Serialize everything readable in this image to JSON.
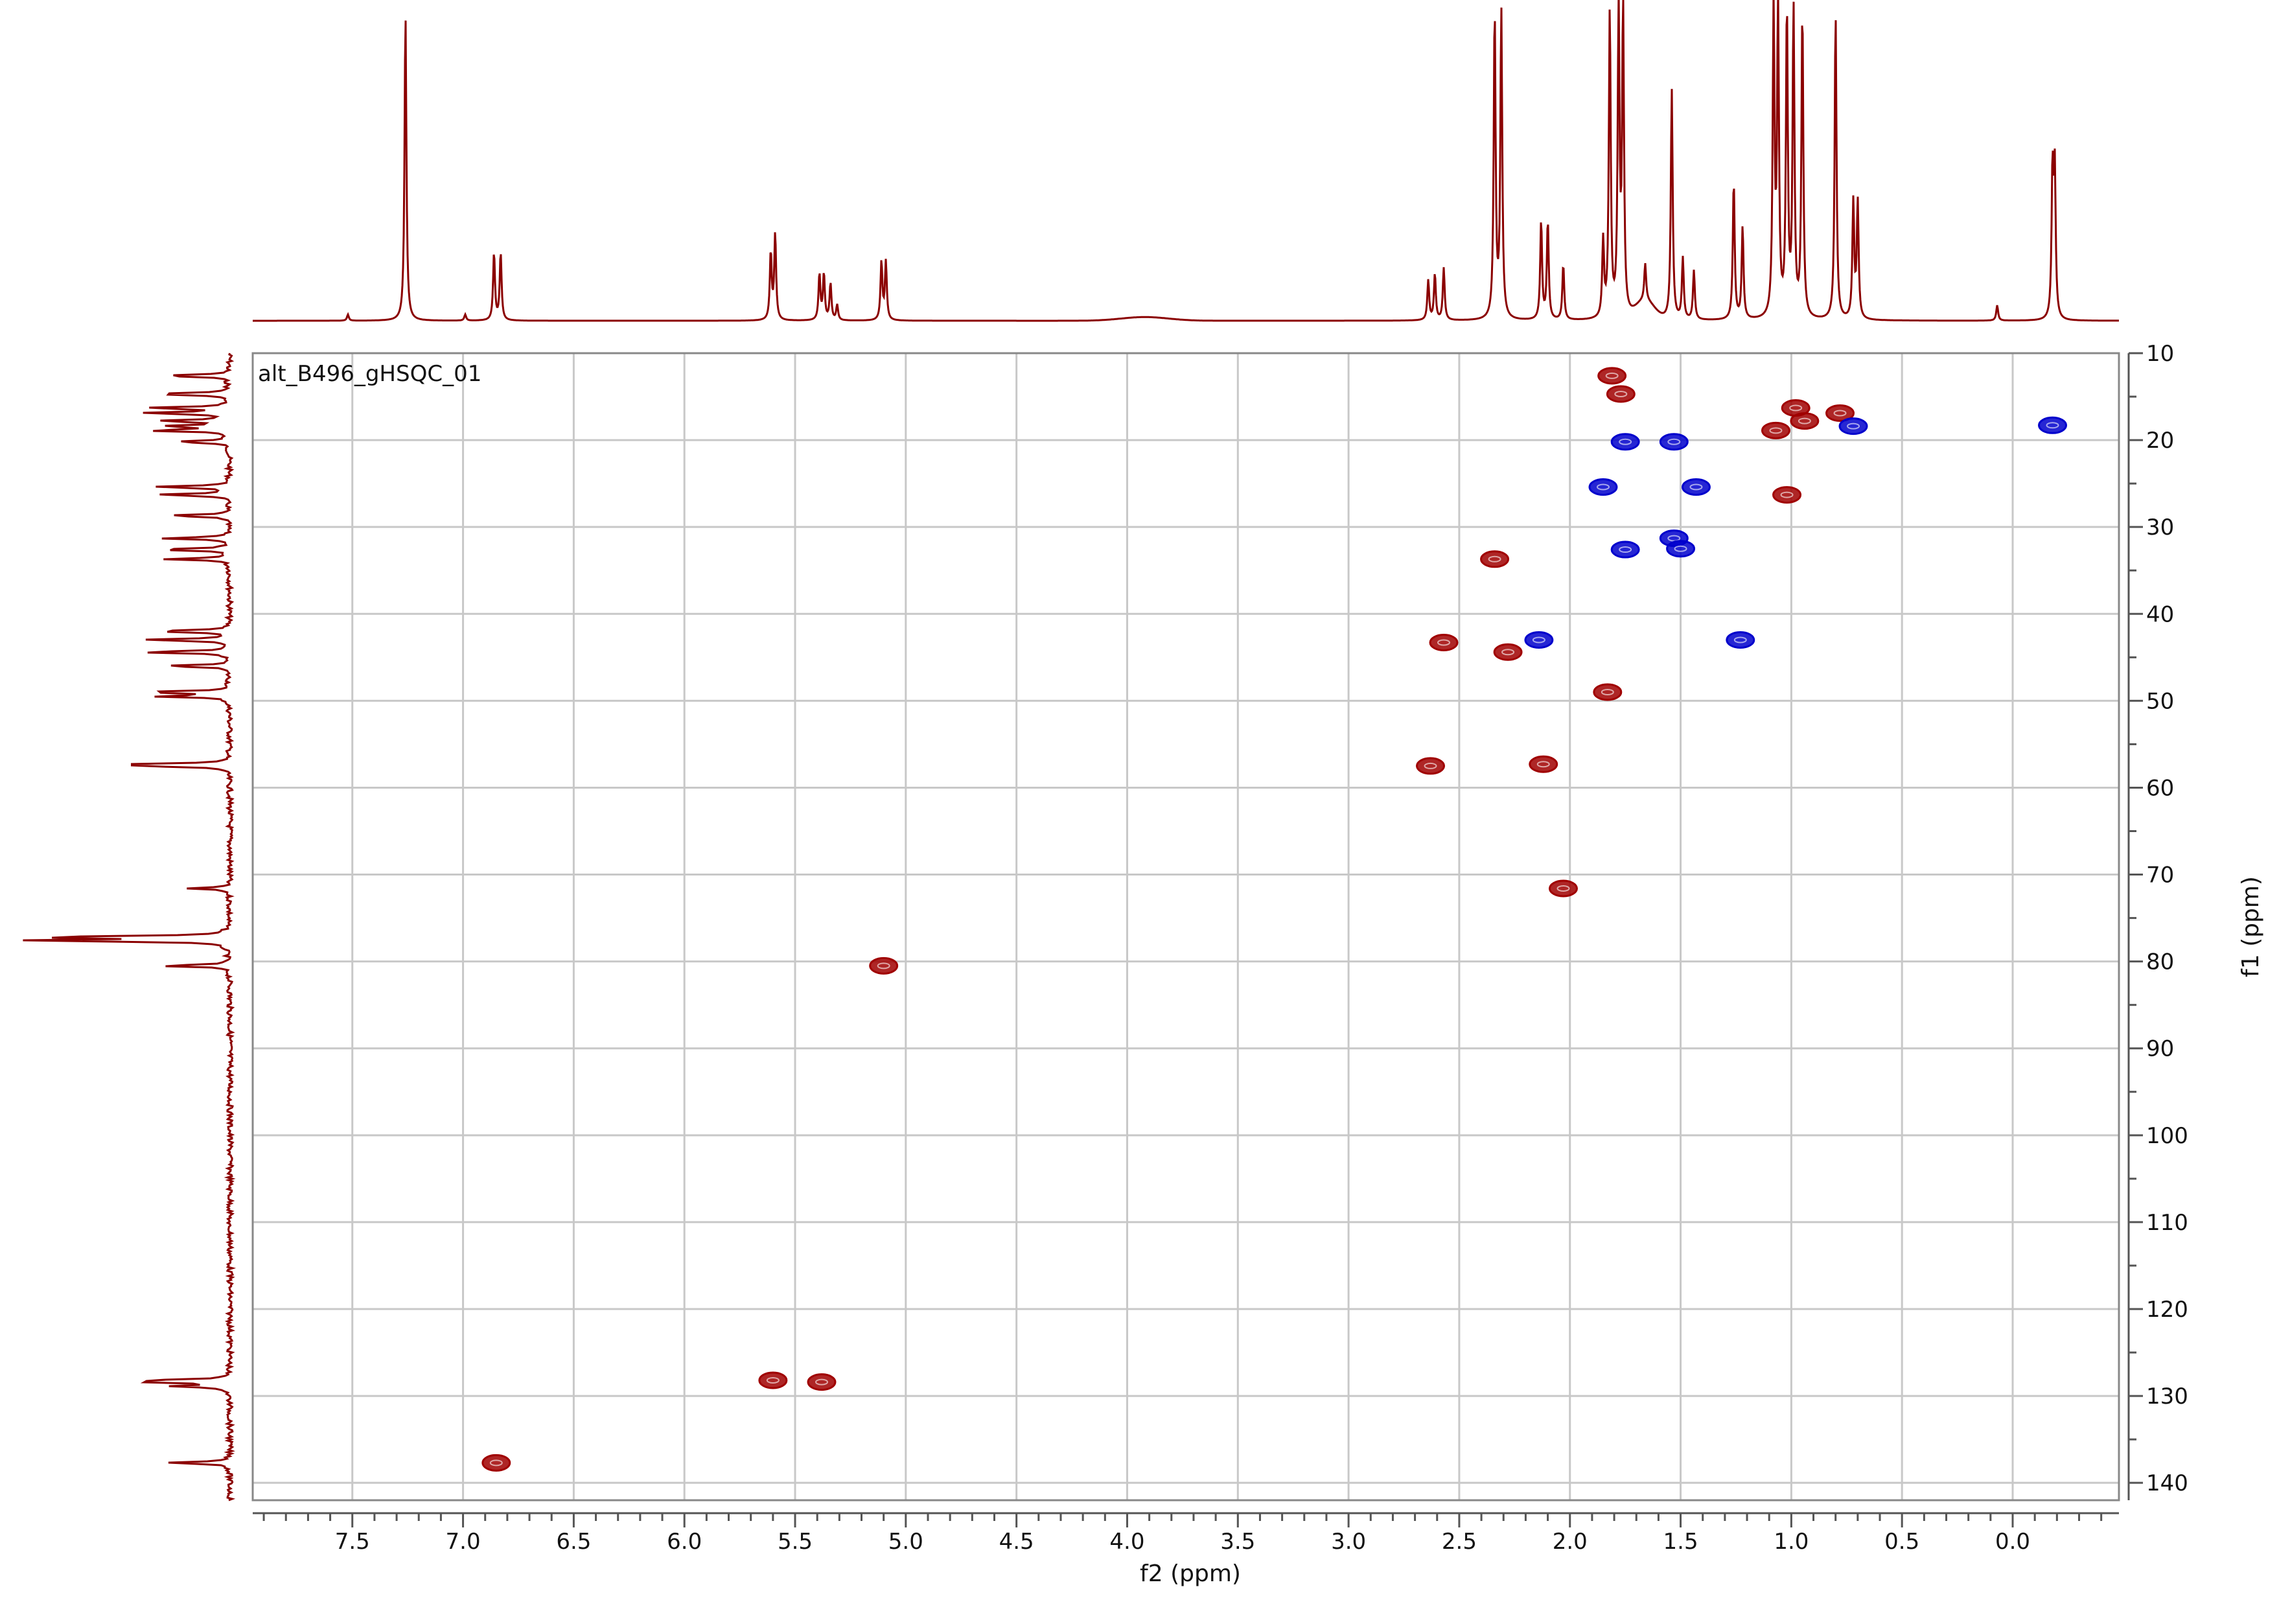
{
  "chart_data": {
    "type": "scatter",
    "experiment_label": "alt_B496_gHSQC_01",
    "xlabel": "f2 (ppm)",
    "ylabel": "f1 (ppm)",
    "xlim": [
      7.95,
      -0.48
    ],
    "ylim": [
      10,
      142
    ],
    "x_ticks": [
      7.5,
      7.0,
      6.5,
      6.0,
      5.5,
      5.0,
      4.5,
      4.0,
      3.5,
      3.0,
      2.5,
      2.0,
      1.5,
      1.0,
      0.5,
      0.0
    ],
    "x_tick_labels": [
      "7.5",
      "7.0",
      "6.5",
      "6.0",
      "5.5",
      "5.0",
      "4.5",
      "4.0",
      "3.5",
      "3.0",
      "2.5",
      "2.0",
      "1.5",
      "1.0",
      "0.5",
      "0.0"
    ],
    "y_ticks": [
      10,
      20,
      30,
      40,
      50,
      60,
      70,
      80,
      90,
      100,
      110,
      120,
      130,
      140
    ],
    "y_tick_labels": [
      "10",
      "20",
      "30",
      "40",
      "50",
      "60",
      "70",
      "80",
      "90",
      "100",
      "110",
      "120",
      "130",
      "140"
    ],
    "grid": true,
    "colors": {
      "positive": "#a00000",
      "negative": "#0000cc",
      "projection": "#8b0000",
      "grid": "#c8c8c8",
      "axis": "#555555"
    },
    "series": [
      {
        "phase": "positive",
        "points": [
          {
            "x": 1.81,
            "y": 12.6
          },
          {
            "x": 1.77,
            "y": 14.7
          },
          {
            "x": 0.98,
            "y": 16.3
          },
          {
            "x": 0.78,
            "y": 16.9
          },
          {
            "x": 0.94,
            "y": 17.8
          },
          {
            "x": 1.07,
            "y": 18.9
          },
          {
            "x": 1.02,
            "y": 26.3
          },
          {
            "x": 2.34,
            "y": 33.7
          },
          {
            "x": 2.57,
            "y": 43.3
          },
          {
            "x": 2.28,
            "y": 44.4
          },
          {
            "x": 1.83,
            "y": 49.0
          },
          {
            "x": 2.63,
            "y": 57.5
          },
          {
            "x": 2.12,
            "y": 57.3
          },
          {
            "x": 2.03,
            "y": 71.6
          },
          {
            "x": 5.1,
            "y": 80.5
          },
          {
            "x": 5.6,
            "y": 128.2
          },
          {
            "x": 5.38,
            "y": 128.4
          },
          {
            "x": 6.85,
            "y": 137.7
          }
        ]
      },
      {
        "phase": "negative",
        "points": [
          {
            "x": -0.18,
            "y": 18.3
          },
          {
            "x": 0.72,
            "y": 18.4
          },
          {
            "x": 1.75,
            "y": 20.2
          },
          {
            "x": 1.53,
            "y": 20.2
          },
          {
            "x": 1.85,
            "y": 25.4
          },
          {
            "x": 1.43,
            "y": 25.4
          },
          {
            "x": 1.53,
            "y": 31.3
          },
          {
            "x": 1.5,
            "y": 32.5
          },
          {
            "x": 1.75,
            "y": 32.6
          },
          {
            "x": 2.14,
            "y": 43.0
          },
          {
            "x": 1.23,
            "y": 43.0
          }
        ]
      }
    ],
    "f2_projection": {
      "peaks": [
        {
          "x": 7.26,
          "h": 1.0
        },
        {
          "x": 7.52,
          "h": 0.02
        },
        {
          "x": 6.99,
          "h": 0.02
        },
        {
          "x": 6.86,
          "h": 0.22
        },
        {
          "x": 6.83,
          "h": 0.22
        },
        {
          "x": 5.61,
          "h": 0.22
        },
        {
          "x": 5.59,
          "h": 0.28
        },
        {
          "x": 5.39,
          "h": 0.15
        },
        {
          "x": 5.37,
          "h": 0.15
        },
        {
          "x": 5.34,
          "h": 0.12
        },
        {
          "x": 5.31,
          "h": 0.05
        },
        {
          "x": 5.11,
          "h": 0.19
        },
        {
          "x": 5.09,
          "h": 0.19
        },
        {
          "x": 2.64,
          "h": 0.13
        },
        {
          "x": 2.61,
          "h": 0.15
        },
        {
          "x": 2.57,
          "h": 0.17
        },
        {
          "x": 2.34,
          "h": 1.0
        },
        {
          "x": 2.31,
          "h": 1.0
        },
        {
          "x": 2.13,
          "h": 0.32
        },
        {
          "x": 2.1,
          "h": 0.32
        },
        {
          "x": 2.03,
          "h": 0.18
        },
        {
          "x": 1.85,
          "h": 0.25
        },
        {
          "x": 1.82,
          "h": 1.0
        },
        {
          "x": 1.78,
          "h": 1.0
        },
        {
          "x": 1.76,
          "h": 1.0
        },
        {
          "x": 1.66,
          "h": 0.12
        },
        {
          "x": 1.54,
          "h": 0.75
        },
        {
          "x": 1.49,
          "h": 0.2
        },
        {
          "x": 1.44,
          "h": 0.16
        },
        {
          "x": 1.26,
          "h": 0.45
        },
        {
          "x": 1.22,
          "h": 0.3
        },
        {
          "x": 1.08,
          "h": 1.0
        },
        {
          "x": 1.06,
          "h": 1.0
        },
        {
          "x": 1.02,
          "h": 1.0
        },
        {
          "x": 0.99,
          "h": 1.0
        },
        {
          "x": 0.95,
          "h": 1.0
        },
        {
          "x": 0.8,
          "h": 1.0
        },
        {
          "x": 0.72,
          "h": 0.38
        },
        {
          "x": 0.7,
          "h": 0.38
        },
        {
          "x": 0.07,
          "h": 0.05
        },
        {
          "x": -0.18,
          "h": 0.47
        },
        {
          "x": -0.19,
          "h": 0.47
        }
      ]
    },
    "f1_projection": {
      "peaks": [
        {
          "y": 12.6,
          "h": 0.35
        },
        {
          "y": 14.7,
          "h": 0.4
        },
        {
          "y": 16.3,
          "h": 0.4
        },
        {
          "y": 16.9,
          "h": 0.42
        },
        {
          "y": 17.8,
          "h": 0.35
        },
        {
          "y": 18.4,
          "h": 0.32
        },
        {
          "y": 18.9,
          "h": 0.38
        },
        {
          "y": 20.2,
          "h": 0.28
        },
        {
          "y": 25.4,
          "h": 0.38
        },
        {
          "y": 26.3,
          "h": 0.35
        },
        {
          "y": 28.7,
          "h": 0.32
        },
        {
          "y": 31.3,
          "h": 0.32
        },
        {
          "y": 32.6,
          "h": 0.38
        },
        {
          "y": 33.7,
          "h": 0.3
        },
        {
          "y": 42.0,
          "h": 0.38
        },
        {
          "y": 43.0,
          "h": 0.42
        },
        {
          "y": 44.4,
          "h": 0.45
        },
        {
          "y": 46.0,
          "h": 0.32
        },
        {
          "y": 49.0,
          "h": 0.42
        },
        {
          "y": 49.5,
          "h": 0.35
        },
        {
          "y": 57.3,
          "h": 0.38
        },
        {
          "y": 57.5,
          "h": 0.38
        },
        {
          "y": 71.6,
          "h": 0.2
        },
        {
          "y": 77.2,
          "h": 0.95
        },
        {
          "y": 77.6,
          "h": 0.95
        },
        {
          "y": 80.5,
          "h": 0.35
        },
        {
          "y": 110.1,
          "h": 0.02
        },
        {
          "y": 128.2,
          "h": 0.32
        },
        {
          "y": 128.4,
          "h": 0.32
        },
        {
          "y": 128.9,
          "h": 0.28
        },
        {
          "y": 137.7,
          "h": 0.3
        }
      ]
    }
  }
}
